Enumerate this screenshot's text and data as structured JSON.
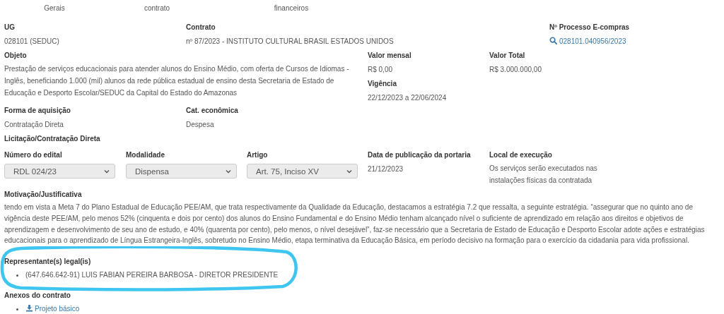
{
  "tabs": [
    {
      "label": "Gerais"
    },
    {
      "label": "contrato"
    },
    {
      "label": "financeiros"
    }
  ],
  "row1": [
    {
      "kind": "text",
      "label": "UG",
      "value": "028101 (SEDUC)"
    },
    {
      "kind": "text",
      "label": "Contrato",
      "value": "nº 87/2023 - INSTITUTO CULTURAL BRASIL ESTADOS UNIDOS"
    },
    {
      "kind": "link",
      "label": "Nº Processo E-compras",
      "value": "028101.040956/2023"
    }
  ],
  "objeto": {
    "label": "Objeto",
    "value": "Prestação de serviços educacionais para atender alunos do Ensino Médio, com oferta de Cursos de Idiomas - Inglês, beneficiando 1.000 (mil) alunos da rede pública estadual de ensino desta Secretaria de Estado de Educação e Desporto Escolar/SEDUC da Capital do Estado do Amazonas"
  },
  "valores": [
    {
      "kind": "text",
      "label": "Valor mensal",
      "value": "R$ 0,00"
    },
    {
      "kind": "text",
      "label": "Vigência",
      "value": "22/12/2023 a 22/06/2024"
    }
  ],
  "valor_total": {
    "kind": "text",
    "label": "Valor Total",
    "value": "R$ 3.000.000,00"
  },
  "row3": [
    {
      "kind": "text",
      "label": "Forma de aquisição",
      "value": "Contratação Direta"
    },
    {
      "kind": "text",
      "label": "Cat. econômica",
      "value": "Despesa"
    }
  ],
  "licitacao_heading": "Licitação/Contratação Direta",
  "row4": [
    {
      "kind": "select",
      "label": "Número do edital",
      "value": "RDL 024/23"
    },
    {
      "kind": "select",
      "label": "Modalidade",
      "value": "Dispensa"
    },
    {
      "kind": "select",
      "label": "Artigo",
      "value": "Art. 75, Inciso XV"
    },
    {
      "kind": "text",
      "label": "Data de publicação da portaria",
      "value": "21/12/2023"
    },
    {
      "kind": "text",
      "label": "Local de execução",
      "value": "Os serviços serão executados nas instalações físicas da contratada"
    }
  ],
  "motivacao": {
    "label": "Motivação/Justificativa",
    "value": "tendo em vista a Meta 7 do Plano Estadual de Educação PEE/AM, que trata respectivamente da Qualidade da Educação, destacamos a estratégia 7.2 que ressalta, a seguinte estratégia. “assegurar que no quinto ano de vigência deste PEE/AM, pelo menos 52% (cinquenta e dois por cento) dos alunos do Ensino Fundamental e do Ensino Médio tenham alcançado nível o suficiente de aprendizado em relação aos direitos e objetivos de aprendizagem e desenvolvimento de seu ano de estudo, e 40% (quarenta por cento), pelo menos, o nível desejável”, faz-se necessário que a Secretaria de Estado de Educação e Desporto Escolar adote ações e estratégias educacionais para o aprendizado de Língua Estrangeira-Inglês, sobretudo no Ensino Médio, etapa terminativa da Educação Básica, em período decisivo na formação para o exercício da cidadania para vida profissional."
  },
  "representantes": {
    "label": "Representante(s) legal(is)",
    "items": [
      {
        "kind": "text",
        "text": "(647.646.642-91) LUIS FABIAN PEREIRA BARBOSA - DIRETOR PRESIDENTE"
      }
    ]
  },
  "anexos": {
    "label": "Anexos do contrato",
    "items": [
      {
        "kind": "download",
        "text": "Projeto básico"
      }
    ]
  }
}
